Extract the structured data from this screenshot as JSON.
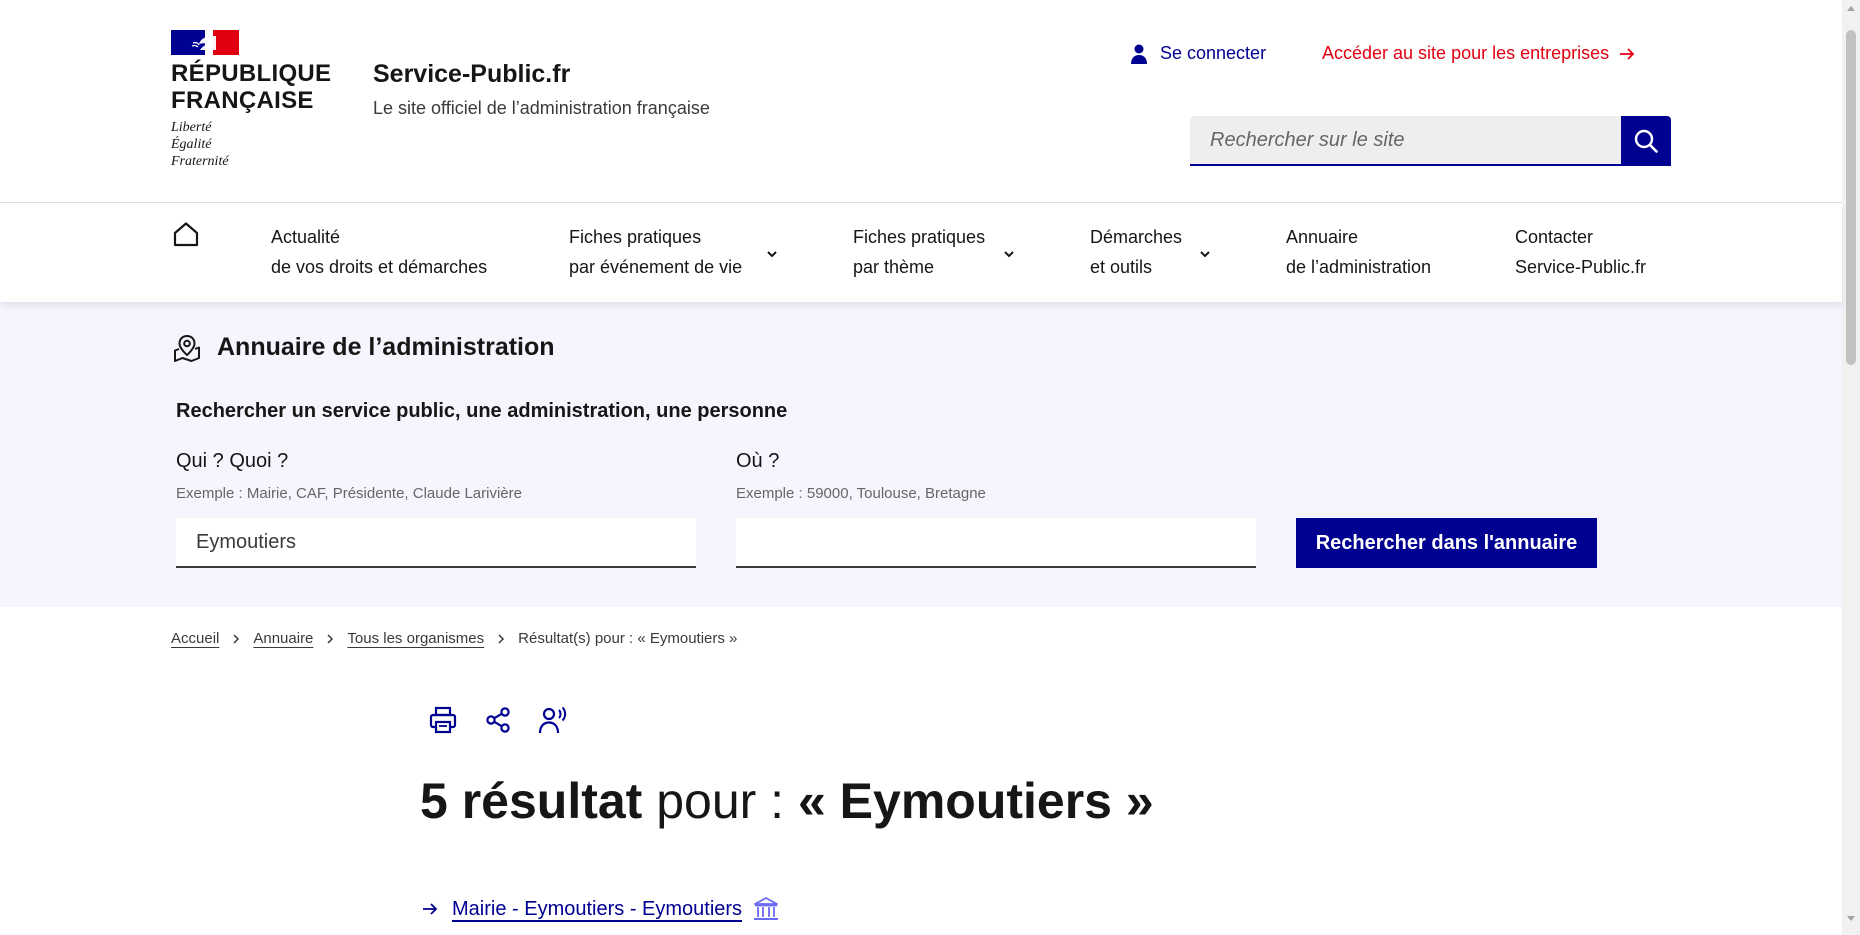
{
  "brand": {
    "republic_line1": "RÉPUBLIQUE",
    "republic_line2": "FRANÇAISE",
    "motto": [
      "Liberté",
      "Égalité",
      "Fraternité"
    ],
    "flag_colors": [
      "#000091",
      "#ffffff",
      "#e1000f"
    ]
  },
  "site": {
    "title": "Service-Public.fr",
    "tagline": "Le site officiel de l’administration française"
  },
  "header": {
    "login_label": "Se connecter",
    "enterprise_label": "Accéder au site pour les entreprises",
    "search_placeholder": "Rechercher sur le site"
  },
  "nav": {
    "items": [
      {
        "line1": "Actualité",
        "line2": "de vos droits et démarches",
        "has_dropdown": false
      },
      {
        "line1": "Fiches pratiques",
        "line2": "par événement de vie",
        "has_dropdown": true
      },
      {
        "line1": "Fiches pratiques",
        "line2": "par thème",
        "has_dropdown": true
      },
      {
        "line1": "Démarches",
        "line2": "et outils",
        "has_dropdown": true
      },
      {
        "line1": "Annuaire",
        "line2": "de l’administration",
        "has_dropdown": false
      },
      {
        "line1": "Contacter",
        "line2": "Service-Public.fr",
        "has_dropdown": false
      }
    ]
  },
  "annuaire": {
    "title": "Annuaire de l’administration",
    "search_heading": "Rechercher un service public, une administration, une personne",
    "who_label": "Qui ? Quoi ?",
    "who_hint": "Exemple : Mairie, CAF, Présidente, Claude Larivière",
    "who_value": "Eymoutiers",
    "where_label": "Où ?",
    "where_hint": "Exemple : 59000, Toulouse, Bretagne",
    "where_value": "",
    "submit_label": "Rechercher dans l'annuaire"
  },
  "breadcrumb": {
    "items": [
      "Accueil",
      "Annuaire",
      "Tous les organismes"
    ],
    "current": "Résultat(s) pour : « Eymoutiers »"
  },
  "results": {
    "count_text": "5 résultat",
    "middle_text": " pour : ",
    "query_text": "« Eymoutiers »",
    "items": [
      {
        "label": "Mairie - Eymoutiers - Eymoutiers",
        "icon": "building-icon"
      }
    ]
  },
  "colors": {
    "accent": "#000091",
    "brand_red": "#e1000f",
    "band_bg": "#f5f5fe"
  }
}
